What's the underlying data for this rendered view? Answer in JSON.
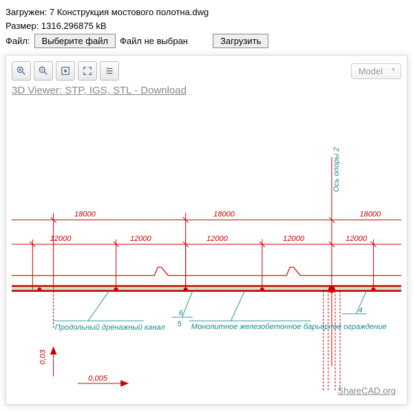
{
  "header": {
    "loaded_label": "Загружен: 7 Конструкция мостового полотна.dwg",
    "size_label": "Размер: 1316.296875 kB",
    "file_label": "Файл:",
    "choose_btn": "Выберите файл",
    "no_file": "Файл не выбран",
    "upload_btn": "Загрузить"
  },
  "toolbar": {
    "model_selected": "Model",
    "viewer_link": "3D Viewer: STP, IGS, STL - Download"
  },
  "drawing": {
    "top_dims": [
      "18000",
      "18000",
      "18000"
    ],
    "sub_dims": [
      "12000",
      "12000",
      "12000",
      "12000",
      "12000"
    ],
    "annotation1": "Продольный дренажный канал",
    "annotation2": "Монолитное железобетонное барьерное ограждение",
    "callout_5": "5",
    "callout_6": "6",
    "callout_4": "4",
    "axis_label": "Ось опоры 2",
    "slope1": "0,03",
    "slope2": "0,005"
  },
  "watermark": "ShareCAD.org"
}
